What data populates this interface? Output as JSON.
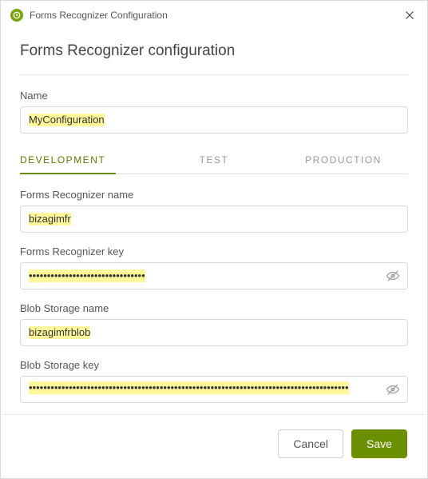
{
  "window": {
    "title": "Forms Recognizer Configuration"
  },
  "heading": "Forms Recognizer configuration",
  "fields": {
    "name": {
      "label": "Name",
      "value": "MyConfiguration"
    },
    "frName": {
      "label": "Forms Recognizer name",
      "value": "bizagimfr"
    },
    "frKey": {
      "label": "Forms Recognizer key",
      "value": "••••••••••••••••••••••••••••••••"
    },
    "blobName": {
      "label": "Blob Storage name",
      "value": "bizagimfrblob"
    },
    "blobKey": {
      "label": "Blob Storage key",
      "value": "••••••••••••••••••••••••••••••••••••••••••••••••••••••••••••••••••••••••••••••••••••••••"
    }
  },
  "tabs": {
    "items": [
      {
        "label": "DEVELOPMENT",
        "active": true
      },
      {
        "label": "TEST",
        "active": false
      },
      {
        "label": "PRODUCTION",
        "active": false
      }
    ]
  },
  "footer": {
    "cancel": "Cancel",
    "save": "Save"
  }
}
